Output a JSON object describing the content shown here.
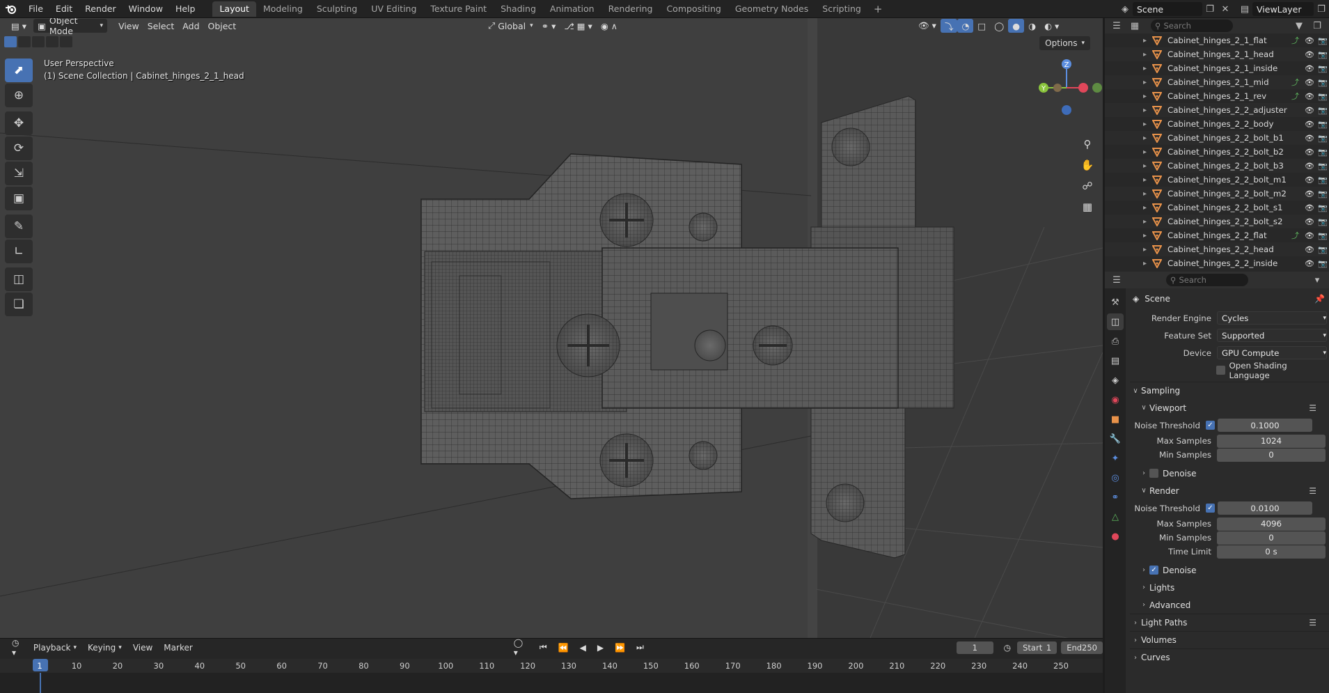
{
  "topbar": {
    "menus": [
      "File",
      "Edit",
      "Render",
      "Window",
      "Help"
    ],
    "workspaces": [
      "Layout",
      "Modeling",
      "Sculpting",
      "UV Editing",
      "Texture Paint",
      "Shading",
      "Animation",
      "Rendering",
      "Compositing",
      "Geometry Nodes",
      "Scripting"
    ],
    "active_workspace": "Layout",
    "scene_name": "Scene",
    "view_layer": "ViewLayer"
  },
  "viewport": {
    "mode": "Object Mode",
    "menus": [
      "View",
      "Select",
      "Add",
      "Object"
    ],
    "transform_orientation": "Global",
    "options_label": "Options",
    "overlay_line1": "User Perspective",
    "overlay_line2": "(1) Scene Collection | Cabinet_hinges_2_1_head"
  },
  "gizmo": {
    "x": "X",
    "y": "Y",
    "z": "Z"
  },
  "outliner": {
    "search_placeholder": "Search",
    "items": [
      {
        "name": "Cabinet_hinges_2_1_flat",
        "modifier": true
      },
      {
        "name": "Cabinet_hinges_2_1_head",
        "modifier": false
      },
      {
        "name": "Cabinet_hinges_2_1_inside",
        "modifier": false
      },
      {
        "name": "Cabinet_hinges_2_1_mid",
        "modifier": true
      },
      {
        "name": "Cabinet_hinges_2_1_rev",
        "modifier": true
      },
      {
        "name": "Cabinet_hinges_2_2_adjuster",
        "modifier": false
      },
      {
        "name": "Cabinet_hinges_2_2_body",
        "modifier": false
      },
      {
        "name": "Cabinet_hinges_2_2_bolt_b1",
        "modifier": false
      },
      {
        "name": "Cabinet_hinges_2_2_bolt_b2",
        "modifier": false
      },
      {
        "name": "Cabinet_hinges_2_2_bolt_b3",
        "modifier": false
      },
      {
        "name": "Cabinet_hinges_2_2_bolt_m1",
        "modifier": false
      },
      {
        "name": "Cabinet_hinges_2_2_bolt_m2",
        "modifier": false
      },
      {
        "name": "Cabinet_hinges_2_2_bolt_s1",
        "modifier": false
      },
      {
        "name": "Cabinet_hinges_2_2_bolt_s2",
        "modifier": false
      },
      {
        "name": "Cabinet_hinges_2_2_flat",
        "modifier": true
      },
      {
        "name": "Cabinet_hinges_2_2_head",
        "modifier": false
      },
      {
        "name": "Cabinet_hinges_2_2_inside",
        "modifier": false
      }
    ]
  },
  "properties": {
    "search_placeholder": "Search",
    "context": "Scene",
    "render_engine_label": "Render Engine",
    "render_engine": "Cycles",
    "feature_set_label": "Feature Set",
    "feature_set": "Supported",
    "device_label": "Device",
    "device": "GPU Compute",
    "osl_label": "Open Shading Language",
    "sampling_label": "Sampling",
    "viewport_label": "Viewport",
    "vp_noise_label": "Noise Threshold",
    "vp_noise": "0.1000",
    "vp_max_label": "Max Samples",
    "vp_max": "1024",
    "vp_min_label": "Min Samples",
    "vp_min": "0",
    "vp_denoise_label": "Denoise",
    "render_label": "Render",
    "r_noise_label": "Noise Threshold",
    "r_noise": "0.0100",
    "r_max_label": "Max Samples",
    "r_max": "4096",
    "r_min_label": "Min Samples",
    "r_min": "0",
    "r_time_label": "Time Limit",
    "r_time": "0 s",
    "r_denoise_label": "Denoise",
    "lights_label": "Lights",
    "advanced_label": "Advanced",
    "light_paths_label": "Light Paths",
    "volumes_label": "Volumes",
    "curves_label": "Curves"
  },
  "timeline": {
    "menus": [
      "Playback",
      "Keying",
      "View",
      "Marker"
    ],
    "current_frame": "1",
    "start_label": "Start",
    "start": "1",
    "end_label": "End",
    "end": "250",
    "ticks": [
      "1",
      "10",
      "20",
      "30",
      "40",
      "50",
      "60",
      "70",
      "80",
      "90",
      "100",
      "110",
      "120",
      "130",
      "140",
      "150",
      "160",
      "170",
      "180",
      "190",
      "200",
      "210",
      "220",
      "230",
      "240",
      "250"
    ]
  },
  "colors": {
    "accent": "#4772b3",
    "mesh_orange": "#e8924a",
    "modifier_green": "#5fb85f"
  }
}
